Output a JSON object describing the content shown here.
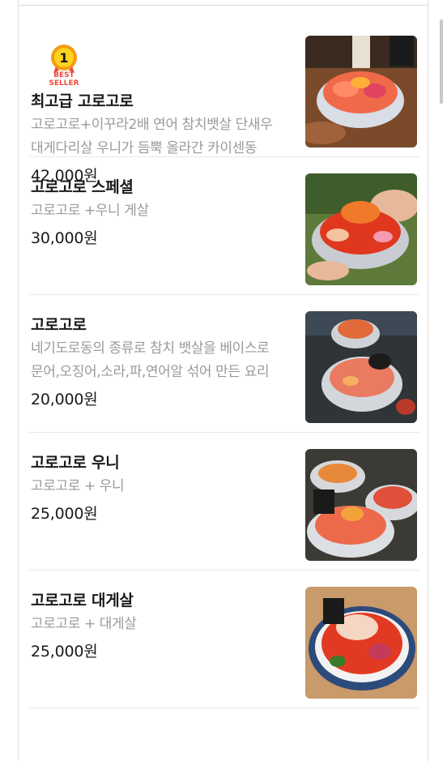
{
  "menu": {
    "items": [
      {
        "badge": {
          "rank": "1",
          "line1": "BEST",
          "line2": "SELLER"
        },
        "name": "최고급 고로고로",
        "desc_lines": [
          "고로고로+이꾸라2배 연어 참치뱃살 단새우",
          "대게다리살 우니가 듬뿍 올라간 카이센동"
        ],
        "price": "42,000원"
      },
      {
        "name": "고로고로 스페셜",
        "desc_lines": [
          "고로고로 +우니 게살"
        ],
        "price": "30,000원"
      },
      {
        "name": "고로고로",
        "desc_lines": [
          "네기도로동의 종류로 참치 뱃살을 베이스로",
          "문어,오징어,소라,파,연어알 섞어 만든 요리"
        ],
        "price": "20,000원"
      },
      {
        "name": "고로고로 우니",
        "desc_lines": [
          "고로고로 + 우니"
        ],
        "price": "25,000원"
      },
      {
        "name": "고로고로 대게살",
        "desc_lines": [
          "고로고로 + 대게살"
        ],
        "price": "25,000원"
      }
    ]
  },
  "colors": {
    "badge_orange": "#f39c12",
    "badge_red": "#e74c3c",
    "price_text": "#1a1a1a",
    "desc_text": "#9a9a9a"
  }
}
